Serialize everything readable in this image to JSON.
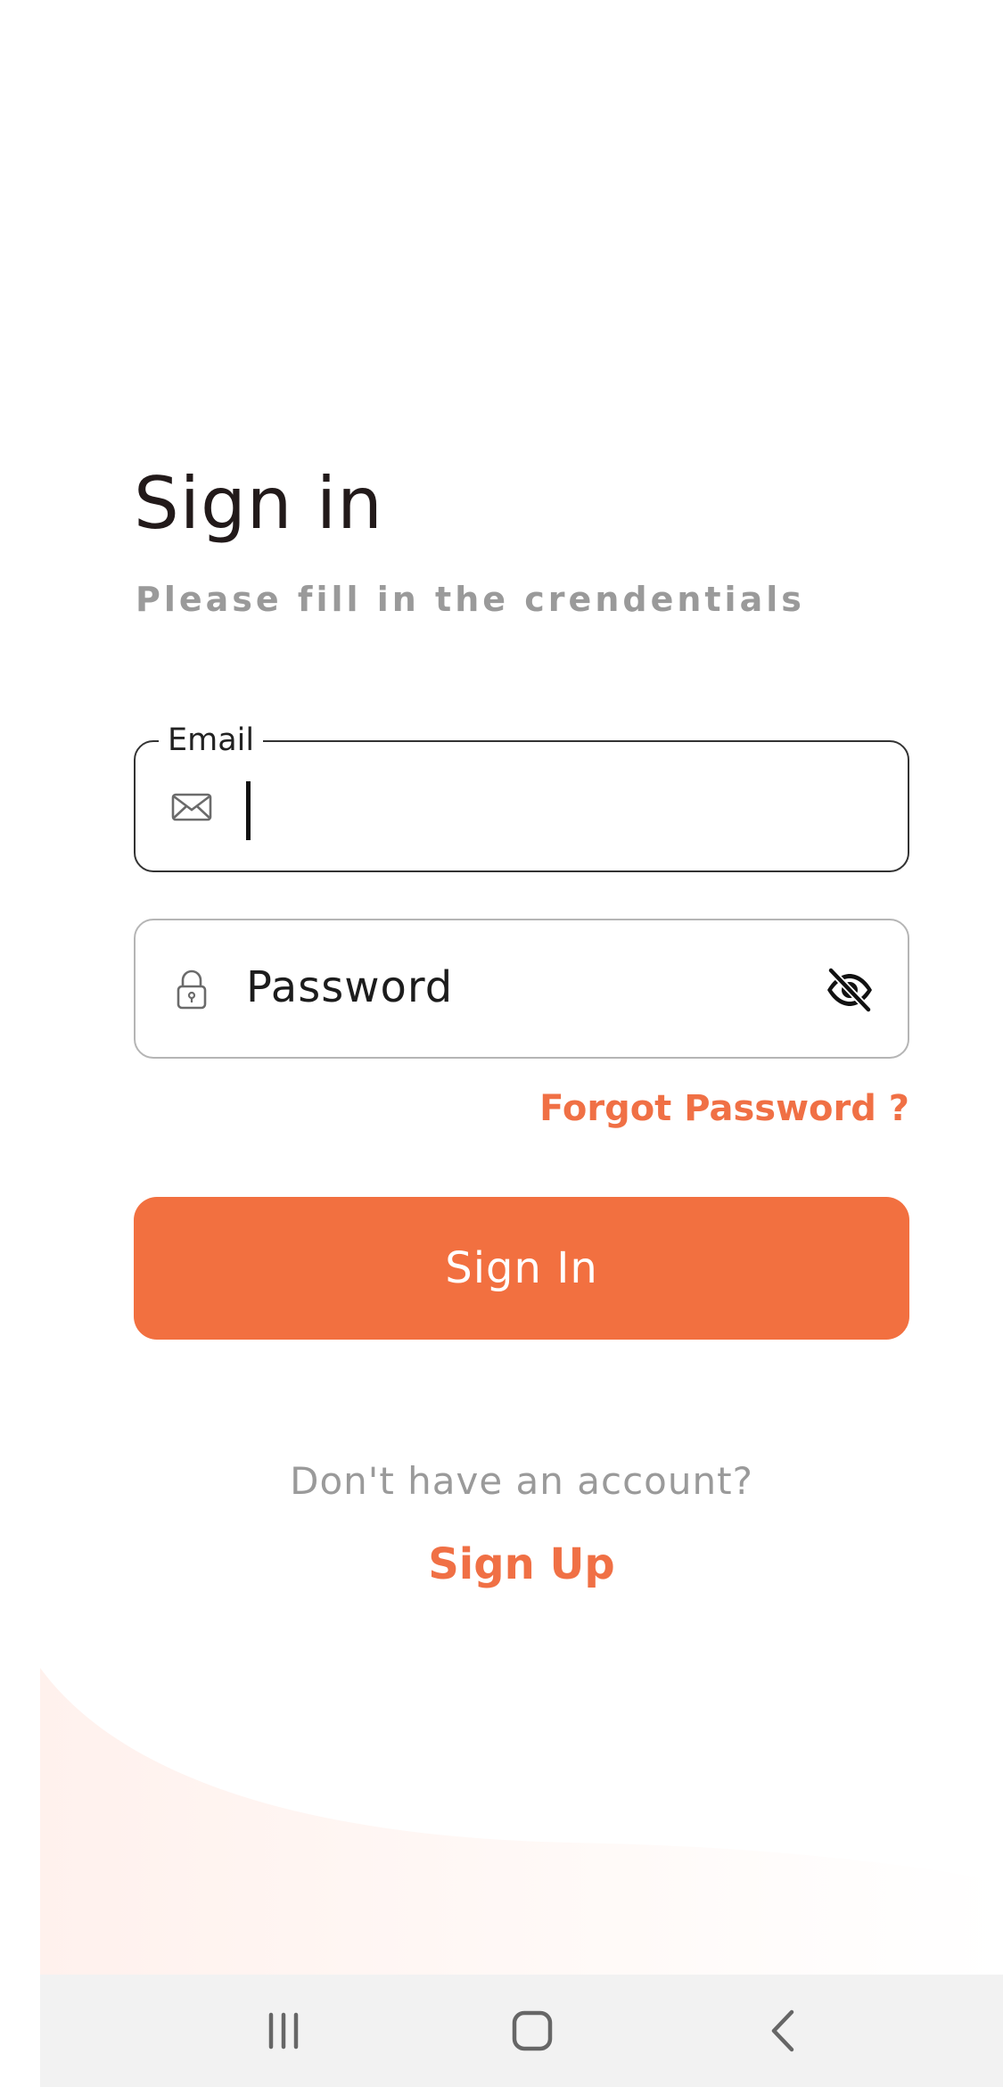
{
  "header": {
    "title": "Sign in",
    "subtitle": "Please fill in the crendentials"
  },
  "form": {
    "email": {
      "label": "Email",
      "value": "",
      "icon": "mail-icon"
    },
    "password": {
      "placeholder": "Password",
      "icon": "lock-icon",
      "toggle_icon": "eye-off-icon"
    },
    "forgot_label": "Forgot Password ?",
    "submit_label": "Sign In"
  },
  "footer": {
    "prompt": "Don't have an account?",
    "signup_label": "Sign Up"
  },
  "system_nav": {
    "items": [
      "recent-apps-icon",
      "home-icon",
      "back-icon"
    ]
  },
  "colors": {
    "accent": "#f27040",
    "title": "#221a1a",
    "muted_text": "#9a9a9a",
    "nav_background": "#f2f2f2"
  }
}
